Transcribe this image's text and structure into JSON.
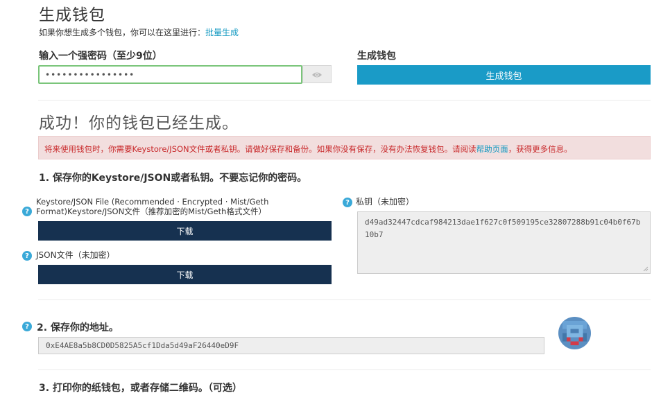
{
  "header": {
    "title": "生成钱包",
    "bulk_text": "如果你想生成多个钱包，你可以在这里进行：",
    "bulk_link": "批量生成"
  },
  "password": {
    "label": "输入一个强密码（至少9位）",
    "value": "••••••••••••••••",
    "toggle_icon": "eye-icon"
  },
  "generate": {
    "label": "生成钱包",
    "button": "生成钱包"
  },
  "success": {
    "title": "成功！你的钱包已经生成。",
    "alert_text": "将来使用钱包时，你需要Keystore/JSON文件或者私钥。请做好保存和备份。如果你没有保存，没有办法恢复钱包。请阅读",
    "alert_link": "帮助页面",
    "alert_tail": "，获得更多信息。"
  },
  "step1": {
    "title": "1. 保存你的Keystore/JSON或者私钥。不要忘记你的密码。",
    "keystore_label_line1": "Keystore/JSON File (Recommended · Encrypted · Mist/Geth",
    "keystore_label_line2": "Format)Keystore/JSON文件（推荐加密的Mist/Geth格式文件）",
    "keystore_button": "下载",
    "json_label": "JSON文件（未加密）",
    "json_button": "下载",
    "private_key_label": "私钥（未加密）",
    "private_key": "d49ad32447cdcaf984213dae1f627c0f509195ce32807288b91c04b0f67b10b7"
  },
  "step2": {
    "title": "2. 保存你的地址。",
    "address": "0xE4AE8a5b8CD0D5825A5cf1Dda5d49aF26440eD9F",
    "identicon": "identicon-avatar"
  },
  "step3": {
    "title": "3. 打印你的纸钱包，或者存储二维码。（可选）"
  },
  "help_icon": "?",
  "colors": {
    "accent": "#1a9bc7",
    "navy": "#163150",
    "alert_bg": "#f2dede",
    "alert_text": "#c8282a",
    "link": "#0e97c0",
    "help": "#3aa9d8"
  }
}
